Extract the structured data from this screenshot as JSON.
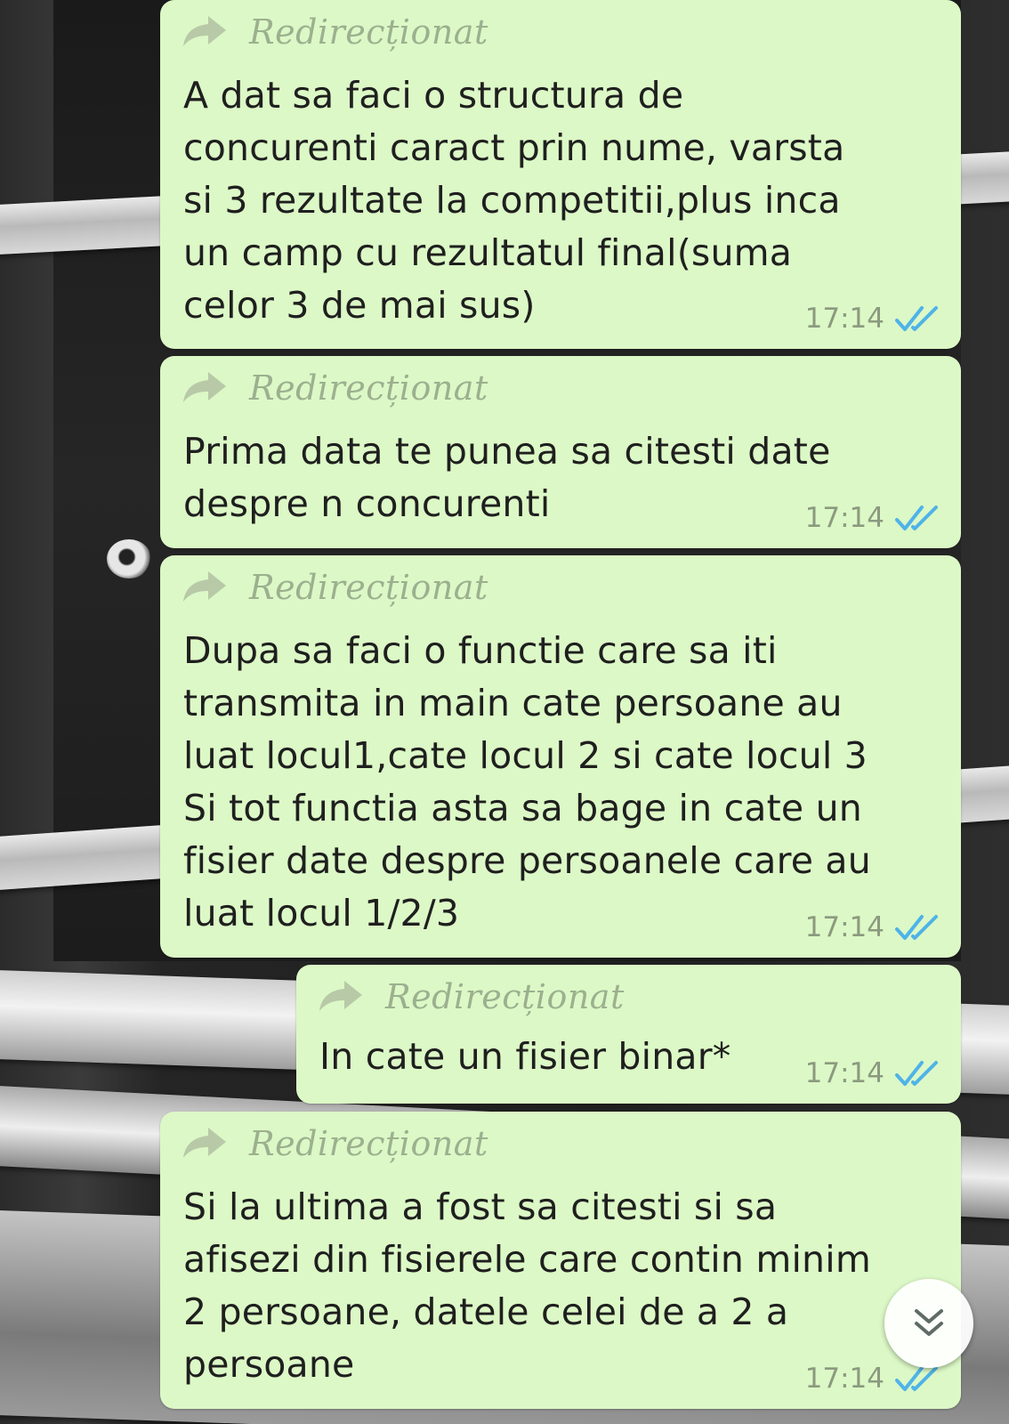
{
  "forward_label": "Redirecționat",
  "messages": [
    {
      "forwarded_label": "Redirecționat",
      "text": "A dat sa faci o structura de\nconcurenti caract prin nume, varsta\nsi 3 rezultate la competitii,plus inca\nun camp cu rezultatul final(suma\ncelor 3 de mai sus)",
      "time": "17:14",
      "status": "read"
    },
    {
      "forwarded_label": "Redirecționat",
      "text": "Prima data te punea sa citesti date\ndespre n concurenti",
      "time": "17:14",
      "status": "read"
    },
    {
      "forwarded_label": "Redirecționat",
      "text": "Dupa sa faci o functie care sa iti\ntransmita in main cate persoane au\nluat locul1,cate locul 2 si cate locul 3\nSi tot functia asta sa bage in cate un\nfisier date despre persoanele care au\nluat locul 1/2/3",
      "time": "17:14",
      "status": "read"
    },
    {
      "forwarded_label": "Redirecționat",
      "text": "In cate un fisier binar*",
      "time": "17:14",
      "status": "read"
    },
    {
      "forwarded_label": "Redirecționat",
      "text": "Si la ultima a fost sa citesti si sa\nafisezi din fisierele care contin minim\n2 persoane, datele celei de a 2 a\npersoane",
      "time": "17:14",
      "status": "read"
    }
  ],
  "icons": {
    "forward": "forward-arrow-icon",
    "read_receipt": "double-check-icon",
    "scroll_down": "chevron-double-down-icon"
  },
  "colors": {
    "outgoing_bubble": "#dcf8c6",
    "read_ticks": "#4fb3e8",
    "forward_label": "#9cb08f",
    "time": "#8b9a7f"
  }
}
